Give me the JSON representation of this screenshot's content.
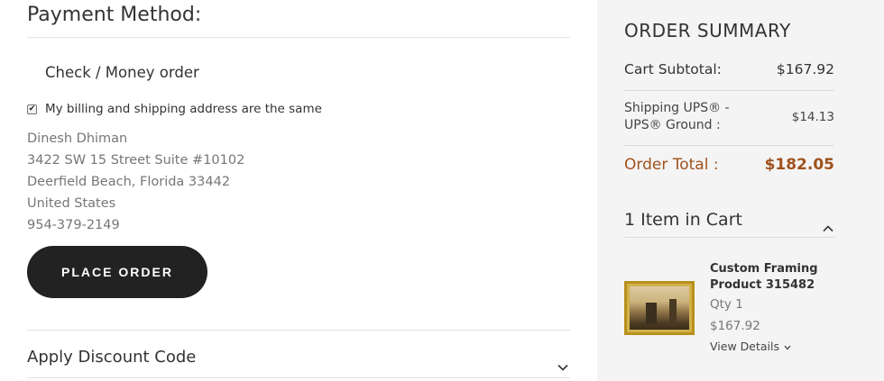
{
  "payment": {
    "title": "Payment Method:",
    "method_name": "Check / Money order",
    "same_address_label": "My billing and shipping address are the same",
    "same_address_checked": true,
    "address_lines": [
      "Dinesh Dhiman",
      "3422 SW 15 Street Suite #10102",
      "Deerfield Beach, Florida 33442",
      "United States",
      "954-379-2149"
    ],
    "place_order_label": "PLACE ORDER"
  },
  "discount": {
    "title": "Apply Discount Code",
    "icon": "chevron-down-icon"
  },
  "summary": {
    "title": "ORDER SUMMARY",
    "subtotal_label": "Cart Subtotal:",
    "subtotal_value": "$167.92",
    "shipping_label_line1": "Shipping UPS® -",
    "shipping_label_line2": "UPS® Ground :",
    "shipping_value": "$14.13",
    "total_label": "Order Total :",
    "total_value": "$182.05",
    "accent_color": "#a0521d"
  },
  "cart": {
    "heading": "1 Item in Cart",
    "icon": "chevron-up-icon",
    "item": {
      "name": "Custom Framing Product 315482",
      "qty": "Qty 1",
      "price": "$167.92",
      "details_label": "View Details"
    }
  }
}
